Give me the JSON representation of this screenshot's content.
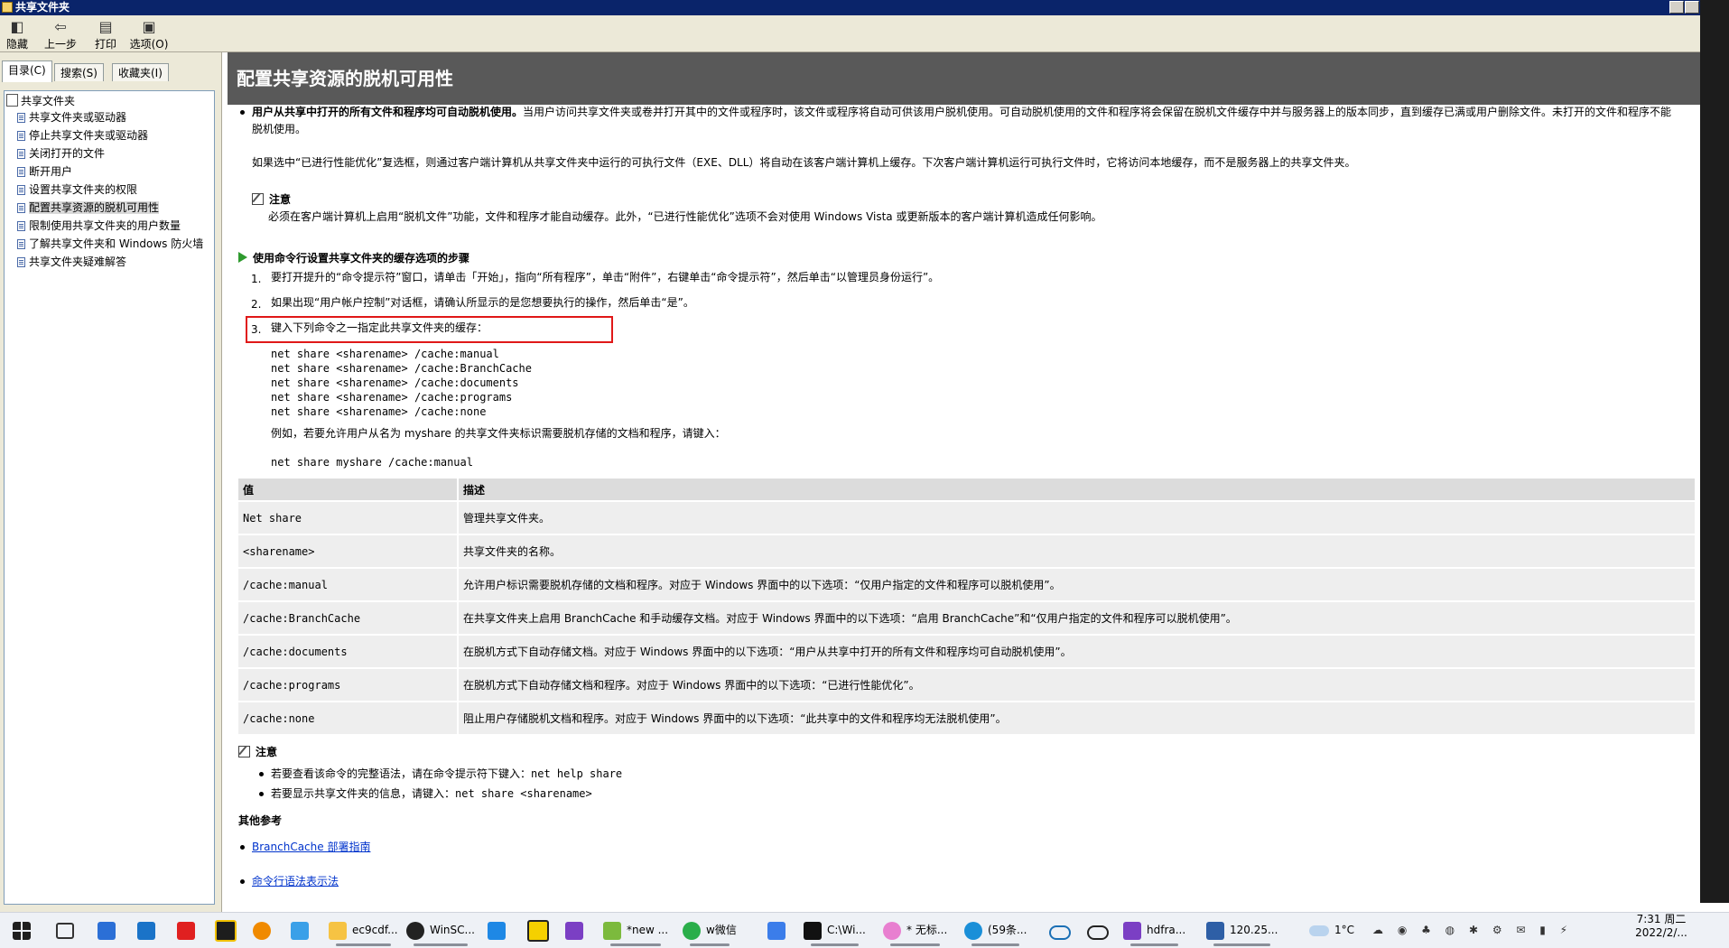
{
  "window": {
    "title": "共享文件夹"
  },
  "toolbar": {
    "hide_label": "隐藏",
    "back_label": "上一步",
    "print_label": "打印",
    "options_label": "选项(O)"
  },
  "tabs": [
    {
      "label": "目录(C)"
    },
    {
      "label": "搜索(S)"
    },
    {
      "label": "收藏夹(I)"
    }
  ],
  "tree": {
    "root": "共享文件夹",
    "items": [
      {
        "label": "共享文件夹或驱动器"
      },
      {
        "label": "停止共享文件夹或驱动器"
      },
      {
        "label": "关闭打开的文件"
      },
      {
        "label": "断开用户"
      },
      {
        "label": "设置共享文件夹的权限"
      },
      {
        "label": "配置共享资源的脱机可用性"
      },
      {
        "label": "限制使用共享文件夹的用户数量"
      },
      {
        "label": "了解共享文件夹和 Windows 防火墙"
      },
      {
        "label": "共享文件夹疑难解答"
      }
    ]
  },
  "content": {
    "title": "配置共享资源的脱机可用性",
    "bullet1_bold": "用户从共享中打开的所有文件和程序均可自动脱机使用。",
    "bullet1_text": "当用户访问共享文件夹或卷并打开其中的文件或程序时，该文件或程序将自动可供该用户脱机使用。可自动脱机使用的文件和程序将会保留在脱机文件缓存中并与服务器上的版本同步，直到缓存已满或用户删除文件。未打开的文件和程序不能",
    "bullet1_cont": "脱机使用。",
    "para_optimize": "如果选中“已进行性能优化”复选框，则通过客户端计算机从共享文件夹中运行的可执行文件（EXE、DLL）将自动在该客户端计算机上缓存。下次客户端计算机运行可执行文件时，它将访问本地缓存，而不是服务器上的共享文件夹。",
    "note_label": "注意",
    "note1_text": "必须在客户端计算机上启用“脱机文件”功能，文件和程序才能自动缓存。此外，“已进行性能优化”选项不会对使用 Windows Vista 或更新版本的客户端计算机造成任何影响。",
    "steps_header": "使用命令行设置共享文件夹的缓存选项的步骤",
    "steps": [
      {
        "num": "1.",
        "text": "要打开提升的“命令提示符”窗口，请单击「开始」，指向“所有程序”，单击“附件”，右键单击“命令提示符”，然后单击“以管理员身份运行”。"
      },
      {
        "num": "2.",
        "text": "如果出现“用户帐户控制”对话框，请确认所显示的是您想要执行的操作，然后单击“是”。"
      },
      {
        "num": "3.",
        "text": "键入下列命令之一指定此共享文件夹的缓存："
      }
    ],
    "commands": [
      "net share <sharename> /cache:manual",
      "net share <sharename> /cache:BranchCache",
      "net share <sharename> /cache:documents",
      "net share <sharename> /cache:programs",
      "net share <sharename> /cache:none"
    ],
    "example_text": "例如，若要允许用户从名为 myshare 的共享文件夹标识需要脱机存储的文档和程序，请键入：",
    "example_cmd": "net share myshare /cache:manual",
    "table": {
      "headers": [
        "值",
        "描述"
      ],
      "rows": [
        {
          "value": "Net share",
          "desc": "管理共享文件夹。"
        },
        {
          "value": "<sharename>",
          "desc": "共享文件夹的名称。"
        },
        {
          "value": "/cache:manual",
          "desc": "允许用户标识需要脱机存储的文档和程序。对应于 Windows 界面中的以下选项：“仅用户指定的文件和程序可以脱机使用”。"
        },
        {
          "value": "/cache:BranchCache",
          "desc": "在共享文件夹上启用 BranchCache 和手动缓存文档。对应于 Windows 界面中的以下选项：“启用 BranchCache”和“仅用户指定的文件和程序可以脱机使用”。"
        },
        {
          "value": "/cache:documents",
          "desc": "在脱机方式下自动存储文档。对应于 Windows 界面中的以下选项：“用户从共享中打开的所有文件和程序均可自动脱机使用”。"
        },
        {
          "value": "/cache:programs",
          "desc": "在脱机方式下自动存储文档和程序。对应于 Windows 界面中的以下选项：“已进行性能优化”。"
        },
        {
          "value": "/cache:none",
          "desc": "阻止用户存储脱机文档和程序。对应于 Windows 界面中的以下选项：“此共享中的文件和程序均无法脱机使用”。"
        }
      ]
    },
    "note2_label": "注意",
    "note2_items": [
      {
        "text": "若要查看该命令的完整语法，请在命令提示符下键入：",
        "code": "net help share"
      },
      {
        "text": "若要显示共享文件夹的信息，请键入：",
        "code": "net share <sharename>"
      }
    ],
    "other_ref": "其他参考",
    "links": [
      "BranchCache 部署指南",
      "命令行语法表示法"
    ]
  },
  "taskbar": {
    "apps": [
      {
        "label": "ec9cdf..."
      },
      {
        "label": "WinSC..."
      },
      {
        "label": "*new ..."
      },
      {
        "label": "w微信"
      },
      {
        "label": "C:\\Wi..."
      },
      {
        "label": "* 无标..."
      },
      {
        "label": "(59条..."
      },
      {
        "label": "hdfra..."
      },
      {
        "label": "120.25..."
      }
    ],
    "temperature": "1°C",
    "time": "7:31 周二",
    "date": "2022/2/..."
  },
  "colors": {
    "title_bar": "#0a246a",
    "content_header": "#595959",
    "highlight_border": "#e01818",
    "link": "#0033cc"
  }
}
